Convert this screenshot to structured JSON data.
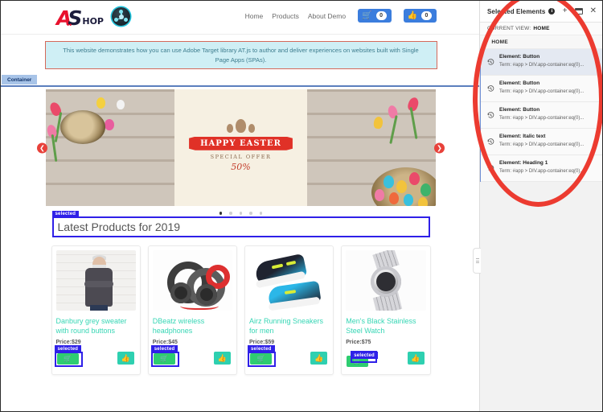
{
  "site": {
    "logo": {
      "a": "A",
      "s": "S",
      "hop": "HOP",
      "dots": "••"
    },
    "nav": [
      {
        "label": "Home"
      },
      {
        "label": "Products"
      },
      {
        "label": "About Demo"
      }
    ],
    "cart": {
      "icon": "cart-icon",
      "count": "0"
    },
    "likes": {
      "icon": "thumbs-up-icon",
      "count": "0"
    },
    "notice": "This website demonstrates how you can use Adobe Target library AT.js to author and deliver experiences on websites built with Single Page Apps (SPAs).",
    "container_badge": "Container",
    "carousel": {
      "prev_icon": "chevron-left-icon",
      "next_icon": "chevron-right-icon",
      "slide_middle": {
        "title": "HAPPY EASTER",
        "subtitle": "SPECIAL OFFER",
        "discount": "50%"
      },
      "dots": 5,
      "active_dot": 0
    },
    "heading": {
      "selected_label": "selected",
      "text": "Latest Products for 2019"
    },
    "products": [
      {
        "title": "Danbury grey sweater with round buttons",
        "price": "Price:$29",
        "selected_label": "selected",
        "buy_icon": "cart-icon",
        "like_icon": "thumbs-up-icon"
      },
      {
        "title": "DBeatz wireless headphones",
        "price": "Price:$45",
        "selected_label": "selected",
        "buy_icon": "cart-icon",
        "like_icon": "thumbs-up-icon"
      },
      {
        "title": "Airz Running Sneakers for men",
        "price": "Price:$59",
        "selected_label": "selected",
        "buy_icon": "cart-icon",
        "like_icon": "thumbs-up-icon"
      },
      {
        "title": "Men's Black Stainless Steel Watch",
        "price": "Price:$75",
        "selected_label": "selected",
        "buy_icon": "cart-icon",
        "like_icon": "thumbs-up-icon"
      }
    ]
  },
  "panel": {
    "title": "Selected Elements",
    "info_icon": "info-icon",
    "add_icon": "plus-icon",
    "window_icon": "window-icon",
    "close_icon": "close-icon",
    "current_view_label": "CURRENT VIEW:",
    "current_view_value": "HOME",
    "group_label": "HOME",
    "caret_icon": "chevron-down-icon",
    "items": [
      {
        "name": "Element: Button",
        "term": "Term: #app > DIV.app-container:eq(0)..."
      },
      {
        "name": "Element: Button",
        "term": "Term: #app > DIV.app-container:eq(0)..."
      },
      {
        "name": "Element: Button",
        "term": "Term: #app > DIV.app-container:eq(0)..."
      },
      {
        "name": "Element: Italic text",
        "term": "Term: #app > DIV.app-container:eq(0)..."
      },
      {
        "name": "Element: Heading 1",
        "term": "Term: #app > DIV.app-container:eq(0)..."
      }
    ]
  },
  "colors": {
    "accent_blue": "#3b7ddd",
    "selected_blue": "#2f20e8",
    "teal_title": "#37d6b5",
    "like_teal": "#2ed0b0",
    "buy_green": "#2ecc71",
    "annotation_red": "#ec3b30",
    "notice_bg": "#cfeff5",
    "notice_border": "#d4695a",
    "panel_bg": "#f2f2f2"
  }
}
